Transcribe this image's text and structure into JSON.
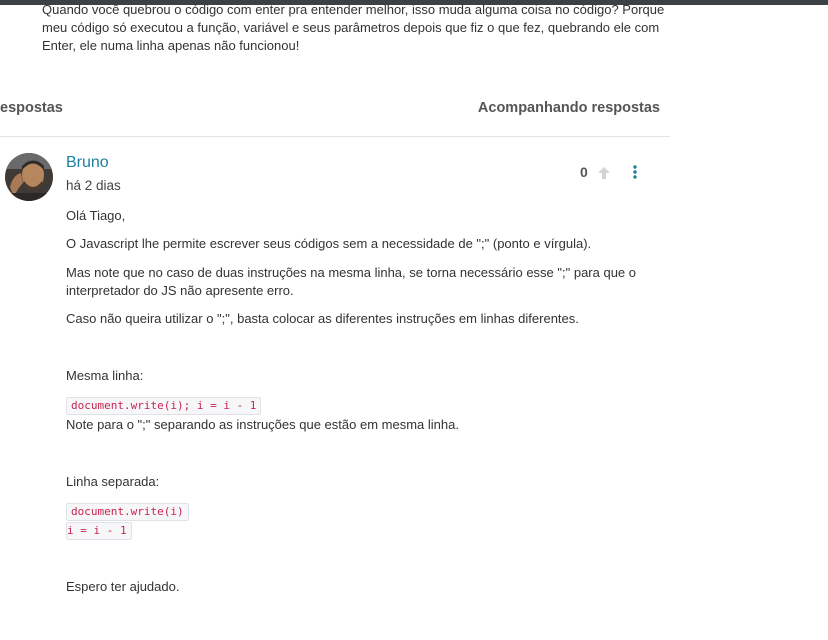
{
  "question": {
    "lines": [
      "Quando você quebrou o código com enter pra entender melhor, isso muda alguma coisa no código? Porque",
      "meu código só executou a função, variável e seus parâmetros depois que fiz o que fez, quebrando ele com",
      "Enter, ele numa linha apenas não funcionou!"
    ]
  },
  "tabs": {
    "left_label": "espostas",
    "right_label": "Acompanhando respostas"
  },
  "answer": {
    "author": "Bruno",
    "date": "há 2 dias",
    "votes": "0",
    "paragraphs": {
      "greeting": "Olá Tiago,",
      "p1": "O Javascript lhe permite escrever seus códigos sem a necessidade de \";\" (ponto e vírgula).",
      "p2a": "Mas note que no caso de duas instruções na mesma linha, se torna necessário esse \";\" para que o",
      "p2b": "interpretador do JS não apresente erro.",
      "p3": "Caso não queira utilizar o \";\", basta colocar as diferentes instruções em linhas diferentes.",
      "same_line_label": "Mesma linha:",
      "code1": "document.write(i); i = i - 1",
      "note": "Note para o \";\" separando as instruções que estão em mesma linha.",
      "separate_label": "Linha separada:",
      "code2": "document.write(i)",
      "code3": "i = i - 1",
      "closing": "Espero ter ajudado."
    }
  },
  "icons": {
    "upvote": "arrow-up-icon",
    "more": "more-vertical-icon",
    "avatar": "user-avatar"
  },
  "colors": {
    "topbar": "#3c4146",
    "author": "#1c7fa0",
    "code_text": "#c7254e",
    "more_icon": "#1c7fa0"
  }
}
